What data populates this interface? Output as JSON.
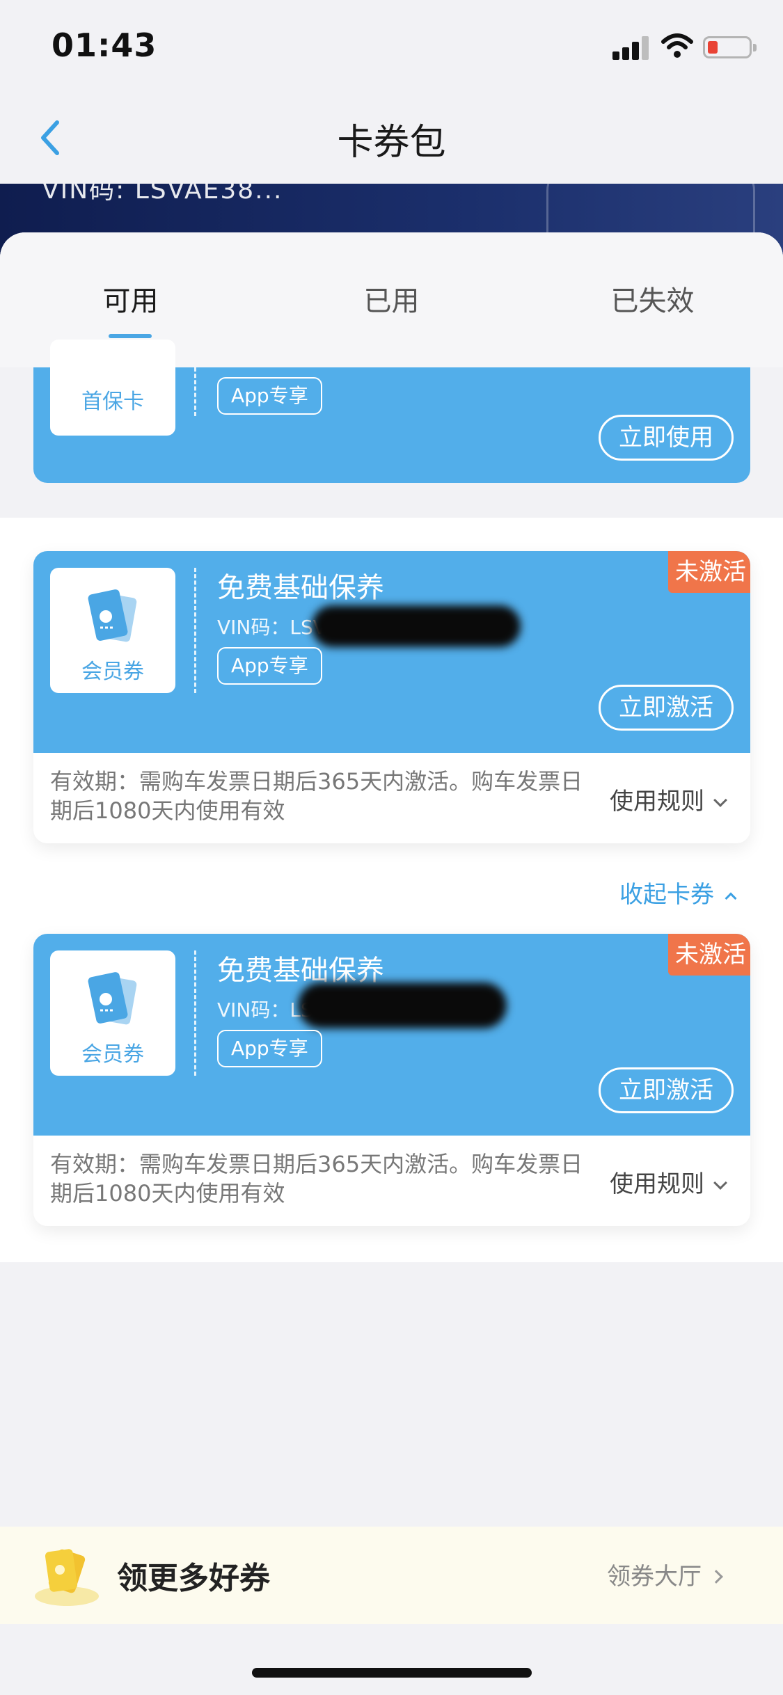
{
  "status_bar": {
    "time": "01:43"
  },
  "nav": {
    "title": "卡券包",
    "back_icon": "chevron-left-icon"
  },
  "banner": {
    "vin_text": "VIN码: LSVAE38..."
  },
  "tabs": [
    {
      "label": "可用",
      "active": true
    },
    {
      "label": "已用",
      "active": false
    },
    {
      "label": "已失效",
      "active": false
    }
  ],
  "partial_card": {
    "icon_label": "首保卡",
    "tag": "App专享",
    "action": "立即使用"
  },
  "cards": [
    {
      "badge": "未激活",
      "icon_label": "会员券",
      "title": "免费基础保养",
      "vin_prefix": "VIN码：LSVA",
      "tag": "App专享",
      "action": "立即激活",
      "validity": "有效期：需购车发票日期后365天内激活。购车发票日期后1080天内使用有效",
      "rules": "使用规则"
    },
    {
      "badge": "未激活",
      "icon_label": "会员券",
      "title": "免费基础保养",
      "vin_prefix": "VIN码：LS",
      "tag": "App专享",
      "action": "立即激活",
      "validity": "有效期：需购车发票日期后365天内激活。购车发票日期后1080天内使用有效",
      "rules": "使用规则"
    }
  ],
  "collapse_label": "收起卡券",
  "promo": {
    "text": "领更多好券",
    "link": "领券大厅"
  },
  "colors": {
    "accent": "#52aeea",
    "badge": "#f0754a",
    "link": "#3ba0e3"
  }
}
